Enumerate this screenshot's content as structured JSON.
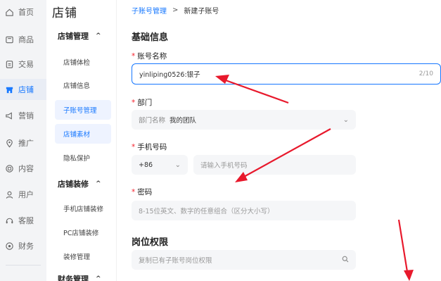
{
  "nav": {
    "items": [
      {
        "label": "首页",
        "icon": "home-icon"
      },
      {
        "label": "商品",
        "icon": "product-icon"
      },
      {
        "label": "交易",
        "icon": "order-icon"
      },
      {
        "label": "店铺",
        "icon": "store-icon"
      },
      {
        "label": "营销",
        "icon": "megaphone-icon"
      },
      {
        "label": "推广",
        "icon": "location-icon"
      },
      {
        "label": "内容",
        "icon": "content-icon"
      },
      {
        "label": "用户",
        "icon": "user-icon"
      },
      {
        "label": "客服",
        "icon": "headset-icon"
      },
      {
        "label": "财务",
        "icon": "finance-icon"
      }
    ],
    "active_label": "店铺",
    "active_color": "#1677ff"
  },
  "subnav": {
    "title": "店铺",
    "groups": [
      {
        "label": "店铺管理",
        "caret": "^",
        "items": [
          "店铺体检",
          "店铺信息",
          "子账号管理",
          "店铺素材",
          "隐私保护"
        ]
      },
      {
        "label": "店铺装修",
        "caret": "^",
        "items": [
          "手机店铺装修",
          "PC店铺装修",
          "装修管理"
        ]
      },
      {
        "label": "财务管理",
        "caret": "^",
        "items": []
      }
    ],
    "selected": "子账号管理"
  },
  "breadcrumb": {
    "parent": "子账号管理",
    "separator": ">",
    "current": "新建子账号"
  },
  "form": {
    "section_basic": "基础信息",
    "account_name": {
      "label": "账号名称",
      "value": "yinliping0526:银子",
      "counter": "2/10"
    },
    "department": {
      "label": "部门",
      "prefix": "部门名称",
      "value": "我的团队"
    },
    "phone": {
      "label": "手机号码",
      "code": "+86",
      "placeholder": "请输入手机号码"
    },
    "password": {
      "label": "密码",
      "placeholder": "8-15位英文、数字的任意组合（区分大小写）"
    },
    "section_perm": "岗位权限",
    "perm_search": {
      "placeholder": "复制已有子账号岗位权限"
    }
  },
  "colors": {
    "accent": "#1677ff",
    "required": "#f5222d",
    "annotation_arrow": "#e8192c"
  }
}
